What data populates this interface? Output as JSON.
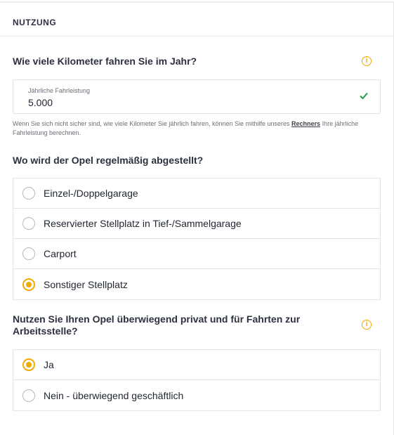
{
  "section": {
    "title": "NUTZUNG"
  },
  "mileage": {
    "question": "Wie viele Kilometer fahren Sie im Jahr?",
    "info_icon": "info-icon",
    "input_label": "Jährliche Fahrleistung",
    "input_value": "5.000",
    "valid_icon": "check-icon",
    "hint_before": "Wenn Sie sich nicht sicher sind, wie viele Kilometer Sie jährlich fahren, können Sie mithilfe unseres ",
    "hint_link": "Rechners",
    "hint_after": " Ihre jährliche Fahrleistung berechnen."
  },
  "parking": {
    "question": "Wo wird der Opel regelmäßig abgestellt?",
    "options": [
      {
        "label": "Einzel-/Doppelgarage",
        "selected": false
      },
      {
        "label": "Reservierter Stellplatz in Tief-/Sammelgarage",
        "selected": false
      },
      {
        "label": "Carport",
        "selected": false
      },
      {
        "label": "Sonstiger Stellplatz",
        "selected": true
      }
    ]
  },
  "usage": {
    "question": "Nutzen Sie Ihren Opel überwiegend privat und für Fahrten zur Arbeitsstelle?",
    "info_icon": "info-icon",
    "options": [
      {
        "label": "Ja",
        "selected": true
      },
      {
        "label": "Nein - überwiegend geschäftlich",
        "selected": false
      }
    ]
  },
  "colors": {
    "accent": "#f2a900",
    "valid": "#1e9e4a",
    "border": "#e3e3e3"
  }
}
